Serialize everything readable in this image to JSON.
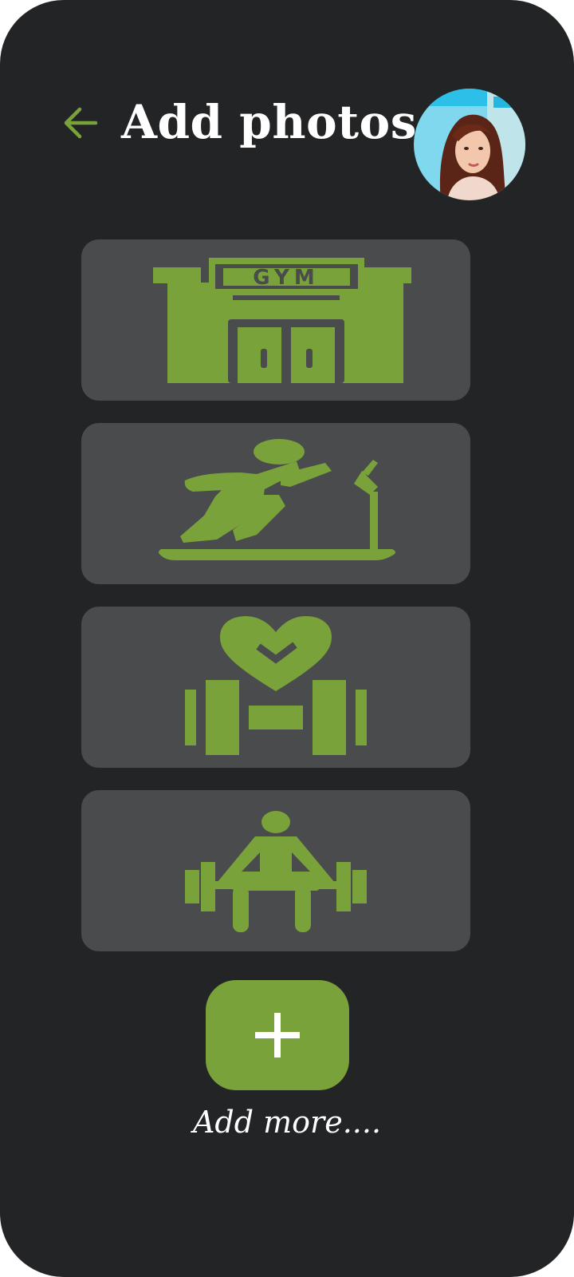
{
  "header": {
    "title": "Add photos",
    "back_icon": "arrow-left-icon",
    "avatar": "user-profile-photo"
  },
  "colors": {
    "background": "#232426",
    "card": "#4a4b4d",
    "accent": "#79a23a",
    "text": "#ffffff"
  },
  "photo_cards": [
    {
      "icon": "gym-building-icon",
      "sign_text": "GYM"
    },
    {
      "icon": "treadmill-runner-icon"
    },
    {
      "icon": "heart-dumbbell-icon"
    },
    {
      "icon": "weightlifter-icon"
    }
  ],
  "add_button": {
    "icon": "plus-icon",
    "label": "Add more...."
  }
}
